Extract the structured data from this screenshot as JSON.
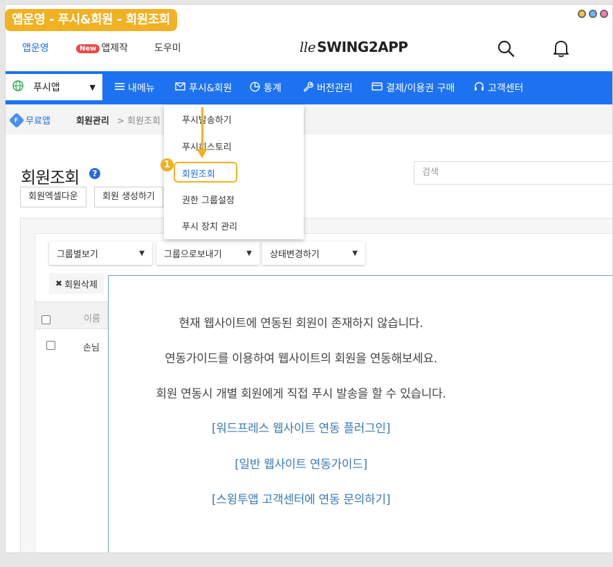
{
  "guide_title": "앱운영 - 푸시&회원 - 회원조회",
  "topnav": {
    "items": [
      {
        "label": "앱운영",
        "active": true
      },
      {
        "label": "앱제작",
        "badge": "New"
      },
      {
        "label": "도우미"
      }
    ],
    "logo": {
      "script": "lle",
      "text": "SWING2APP"
    }
  },
  "menubar": {
    "app_select": "푸시앱",
    "items": [
      {
        "label": "내메뉴",
        "icon": "list-icon"
      },
      {
        "label": "푸시&회원",
        "icon": "mail-icon"
      },
      {
        "label": "통계",
        "icon": "pie-chart-icon"
      },
      {
        "label": "버전관리",
        "icon": "wrench-icon"
      },
      {
        "label": "결제/이용권 구매",
        "icon": "card-icon"
      },
      {
        "label": "고객센터",
        "icon": "headset-icon"
      }
    ]
  },
  "breadcrumb": {
    "free_badge": "F",
    "free_label": "무료앱",
    "main": "회원관리",
    "sep": ">",
    "sub": "회원조회"
  },
  "submenu": {
    "items": [
      "푸시발송하기",
      "푸시히스토리",
      "회원조회",
      "권한 그룹설정",
      "푸시 장치 관리"
    ],
    "highlighted_index": 2,
    "step_number": "1"
  },
  "page": {
    "title": "회원조회",
    "help": "?",
    "buttons": [
      "회원엑셀다운",
      "회원 생성하기"
    ],
    "search_placeholder": "검색"
  },
  "toolbar": {
    "dropdowns": [
      "그룹별보기",
      "그룹으로보내기",
      "상태변경하기"
    ],
    "delete_label": "회원삭제"
  },
  "table": {
    "header_name": "이름",
    "rows": [
      {
        "name": "손님"
      }
    ]
  },
  "empty_message": {
    "lines": [
      "현재 웹사이트에 연동된 회원이 존재하지 않습니다.",
      "연동가이드를 이용하여 웹사이트의 회원을 연동해보세요.",
      "회원 연동시 개별 회원에게 직접 푸시 발송을 할 수 있습니다."
    ],
    "links": [
      "[워드프레스 웹사이트 연동 플러그인]",
      "[일반 웹사이트 연동가이드]",
      "[스윙투앱 고객센터에 연동 문의하기]"
    ]
  },
  "colors": {
    "brand_blue": "#1d72f2",
    "guide_accent": "#f0b122",
    "link": "#3a7ab5"
  }
}
